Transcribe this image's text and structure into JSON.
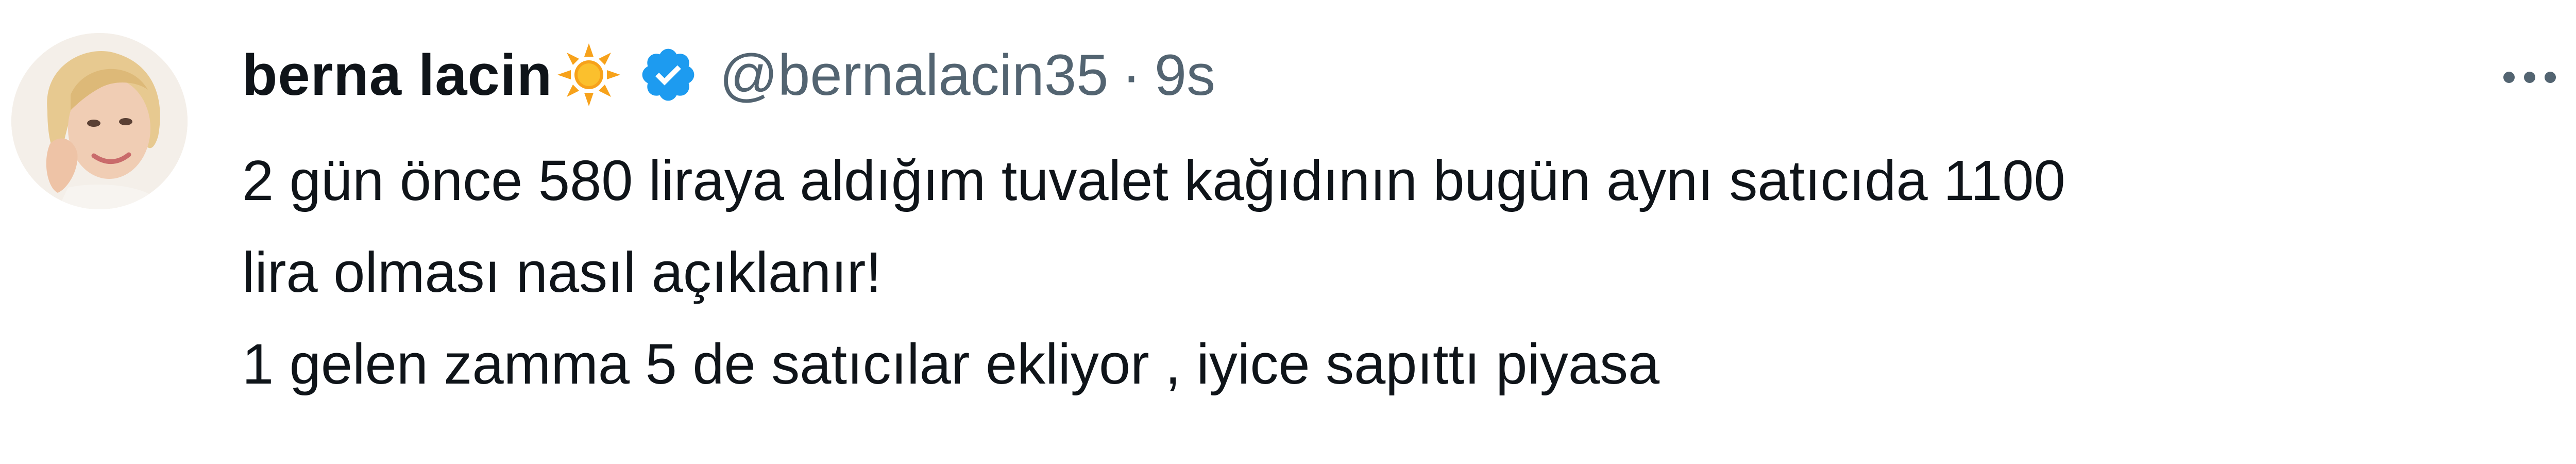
{
  "tweet": {
    "author": {
      "name": "berna lacin",
      "handle": "@bernalacin35",
      "separator": "·",
      "time": "9s",
      "badge_icon": "sun-emoji-icon",
      "verified_icon": "verified-badge-icon",
      "verified_color": "#1d9bf0"
    },
    "text_lines": [
      "2 gün önce 580 liraya aldığım tuvalet kağıdının bugün aynı satıcıda 1100",
      "lira olması nasıl açıklanır!",
      "1 gelen zamma 5 de satıcılar ekliyor , iyice sapıttı piyasa"
    ],
    "more_icon": "more-horizontal-icon"
  },
  "colors": {
    "text_primary": "#0f1419",
    "text_secondary": "#536471",
    "background": "#ffffff",
    "verified": "#1d9bf0",
    "sun": "#f7a21b"
  }
}
